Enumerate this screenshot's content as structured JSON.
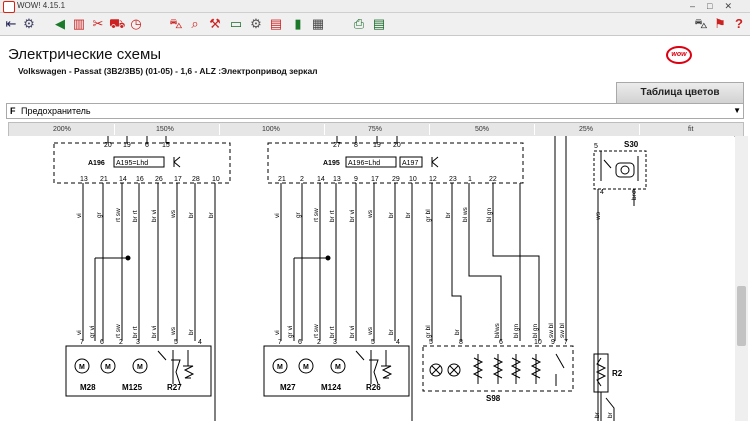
{
  "window": {
    "title": "WOW! 4.15.1"
  },
  "header": {
    "title": "Электрические схемы",
    "vehicle": "Volkswagen - Passat (3B2/3B5) (01-05) - 1,6 - ALZ :",
    "function": "Электропривод зеркал",
    "color_table_button": "Таблица цветов"
  },
  "fuse_select": {
    "letter": "F",
    "value": "Предохранитель"
  },
  "zoom": {
    "levels": [
      "200%",
      "150%",
      "100%",
      "75%",
      "50%",
      "25%",
      "fit"
    ]
  },
  "diagram": {
    "left_connector": {
      "name": "A196",
      "tag": "A195=Lhd",
      "top_pins": [
        "20",
        "19",
        "6",
        "15"
      ],
      "bottom_pins": [
        "13",
        "21",
        "14",
        "16",
        "26",
        "17",
        "28",
        "10"
      ]
    },
    "right_connector": {
      "name": "A195",
      "tag": "A196=Lhd",
      "tag2": "A197",
      "top_pins": [
        "27",
        "8",
        "19",
        "20"
      ],
      "bottom_pins": [
        "21",
        "2",
        "14",
        "13",
        "9",
        "17",
        "29",
        "10",
        "12",
        "23",
        "1",
        "22"
      ]
    },
    "s30": {
      "label": "S30",
      "pins": [
        "5",
        "4",
        "6"
      ],
      "wire_bottom": [
        "ws",
        "br"
      ]
    },
    "left_wires_top": [
      "vi",
      "gr",
      "rt sw",
      "br rt",
      "br vi",
      "ws",
      "br",
      "br"
    ],
    "left_wires_bottom": [
      "vi",
      "gr vi",
      "rt sw",
      "br rt",
      "br vi",
      "ws",
      "br"
    ],
    "left_group_pins": [
      "7",
      "6",
      "2",
      "3",
      "5",
      "4"
    ],
    "left_components": [
      "M28",
      "M125",
      "R27"
    ],
    "right_wires_top": [
      "vi",
      "gr",
      "rt sw",
      "br rt",
      "br vi",
      "ws",
      "br",
      "br",
      "gr bl",
      "br",
      "bl ws",
      "bl gn"
    ],
    "right_wires_bottom": [
      "vi",
      "gr vi",
      "rt sw",
      "br rt",
      "br vi",
      "ws",
      "br",
      "gr bl",
      "br",
      "bl/ws",
      "bl gn",
      "bl gn",
      "sw bl",
      "sw bl"
    ],
    "right_group_pins": [
      "7",
      "6",
      "2",
      "3",
      "5",
      "4"
    ],
    "right_components": [
      "M27",
      "M124",
      "R26"
    ],
    "s98": {
      "label": "S98",
      "pins": [
        "5",
        "8",
        "6",
        "10",
        "9",
        "7"
      ]
    },
    "r2": {
      "label": "R2",
      "wire_bottom": [
        "br",
        "br"
      ]
    }
  }
}
